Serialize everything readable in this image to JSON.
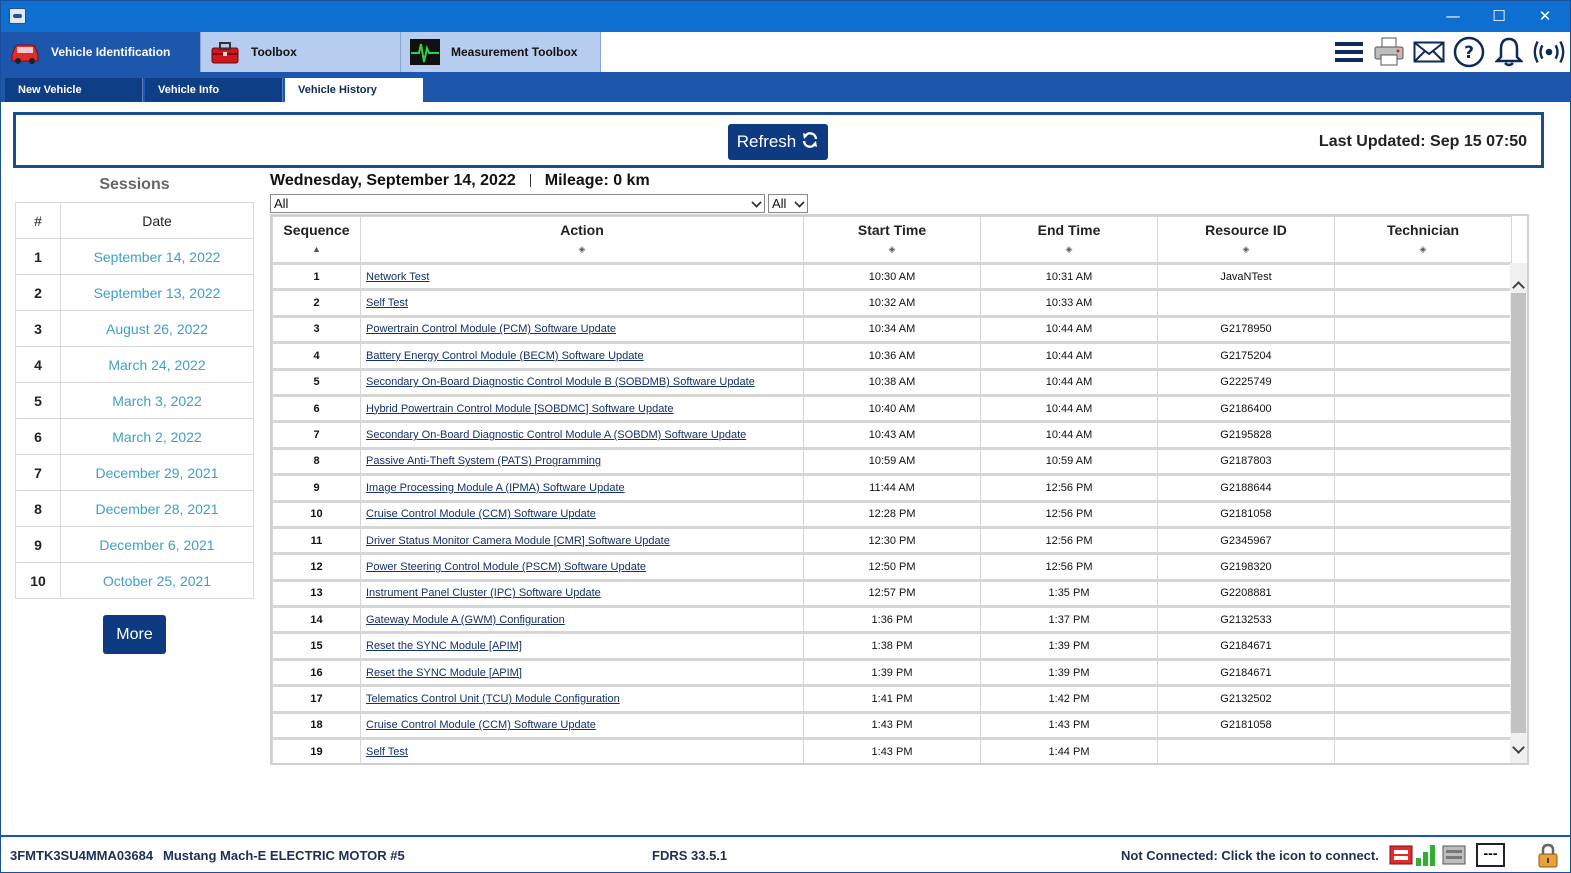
{
  "window": {
    "minimize_glyph": "—",
    "maximize_glyph": "☐",
    "close_glyph": "✕"
  },
  "main_tabs": [
    {
      "label": "Vehicle Identification",
      "icon": "car-icon"
    },
    {
      "label": "Toolbox",
      "icon": "toolbox-icon"
    },
    {
      "label": "Measurement Toolbox",
      "icon": "oscilloscope-icon"
    }
  ],
  "toolbar_icons": [
    "menu-icon",
    "printer-icon",
    "mail-icon",
    "help-icon",
    "bell-icon",
    "wireless-icon"
  ],
  "sub_tabs": [
    {
      "label": "New Vehicle"
    },
    {
      "label": "Vehicle Info"
    },
    {
      "label": "Vehicle History"
    }
  ],
  "refresh": {
    "label": "Refresh",
    "last_updated": "Last Updated: Sep 15 07:50"
  },
  "sessions": {
    "title": "Sessions",
    "col_num": "#",
    "col_date": "Date",
    "rows": [
      {
        "num": "1",
        "date": "September 14, 2022"
      },
      {
        "num": "2",
        "date": "September 13, 2022"
      },
      {
        "num": "3",
        "date": "August 26, 2022"
      },
      {
        "num": "4",
        "date": "March 24, 2022"
      },
      {
        "num": "5",
        "date": "March 3, 2022"
      },
      {
        "num": "6",
        "date": "March 2, 2022"
      },
      {
        "num": "7",
        "date": "December 29, 2021"
      },
      {
        "num": "8",
        "date": "December 28, 2021"
      },
      {
        "num": "9",
        "date": "December 6, 2021"
      },
      {
        "num": "10",
        "date": "October 25, 2021"
      }
    ],
    "more_label": "More"
  },
  "history": {
    "date": "Wednesday, September 14, 2022",
    "mileage": "Mileage: 0 km",
    "filter_action": "All",
    "filter_all": "All",
    "columns": [
      "Sequence",
      "Action",
      "Start Time",
      "End Time",
      "Resource ID",
      "Technician"
    ],
    "sort_asc_glyph": "▲",
    "sort_glyph": "◈",
    "rows": [
      {
        "seq": "1",
        "action": "Network Test",
        "start": "10:30 AM",
        "end": "10:31 AM",
        "resource": "JavaNTest",
        "tech": ""
      },
      {
        "seq": "2",
        "action": "Self Test",
        "start": "10:32 AM",
        "end": "10:33 AM",
        "resource": "",
        "tech": ""
      },
      {
        "seq": "3",
        "action": "Powertrain Control Module (PCM) Software Update",
        "start": "10:34 AM",
        "end": "10:44 AM",
        "resource": "G2178950",
        "tech": ""
      },
      {
        "seq": "4",
        "action": "Battery Energy Control Module (BECM) Software Update",
        "start": "10:36 AM",
        "end": "10:44 AM",
        "resource": "G2175204",
        "tech": ""
      },
      {
        "seq": "5",
        "action": "Secondary On-Board Diagnostic Control Module B (SOBDMB) Software Update",
        "start": "10:38 AM",
        "end": "10:44 AM",
        "resource": "G2225749",
        "tech": ""
      },
      {
        "seq": "6",
        "action": "Hybrid Powertrain Control Module [SOBDMC] Software Update",
        "start": "10:40 AM",
        "end": "10:44 AM",
        "resource": "G2186400",
        "tech": ""
      },
      {
        "seq": "7",
        "action": "Secondary On-Board Diagnostic Control Module A (SOBDM) Software Update",
        "start": "10:43 AM",
        "end": "10:44 AM",
        "resource": "G2195828",
        "tech": ""
      },
      {
        "seq": "8",
        "action": "Passive Anti-Theft System (PATS) Programming",
        "start": "10:59 AM",
        "end": "10:59 AM",
        "resource": "G2187803",
        "tech": ""
      },
      {
        "seq": "9",
        "action": "Image Processing Module A (IPMA) Software Update",
        "start": "11:44 AM",
        "end": "12:56 PM",
        "resource": "G2188644",
        "tech": ""
      },
      {
        "seq": "10",
        "action": "Cruise Control Module (CCM) Software Update",
        "start": "12:28 PM",
        "end": "12:56 PM",
        "resource": "G2181058",
        "tech": ""
      },
      {
        "seq": "11",
        "action": "Driver Status Monitor Camera Module [CMR] Software Update",
        "start": "12:30 PM",
        "end": "12:56 PM",
        "resource": "G2345967",
        "tech": ""
      },
      {
        "seq": "12",
        "action": "Power Steering Control Module (PSCM) Software Update",
        "start": "12:50 PM",
        "end": "12:56 PM",
        "resource": "G2198320",
        "tech": ""
      },
      {
        "seq": "13",
        "action": "Instrument Panel Cluster (IPC) Software Update",
        "start": "12:57 PM",
        "end": "1:35 PM",
        "resource": "G2208881",
        "tech": ""
      },
      {
        "seq": "14",
        "action": "Gateway Module A (GWM) Configuration",
        "start": "1:36 PM",
        "end": "1:37 PM",
        "resource": "G2132533",
        "tech": ""
      },
      {
        "seq": "15",
        "action": "Reset the SYNC Module [APIM]",
        "start": "1:38 PM",
        "end": "1:39 PM",
        "resource": "G2184671",
        "tech": ""
      },
      {
        "seq": "16",
        "action": "Reset the SYNC Module [APIM]",
        "start": "1:39 PM",
        "end": "1:39 PM",
        "resource": "G2184671",
        "tech": ""
      },
      {
        "seq": "17",
        "action": "Telematics Control Unit (TCU) Module Configuration",
        "start": "1:41 PM",
        "end": "1:42 PM",
        "resource": "G2132502",
        "tech": ""
      },
      {
        "seq": "18",
        "action": "Cruise Control Module (CCM) Software Update",
        "start": "1:43 PM",
        "end": "1:43 PM",
        "resource": "G2181058",
        "tech": ""
      },
      {
        "seq": "19",
        "action": "Self Test",
        "start": "1:43 PM",
        "end": "1:44 PM",
        "resource": "",
        "tech": ""
      }
    ]
  },
  "status": {
    "vin": "3FMTK3SU4MMA03684",
    "model": "Mustang Mach-E ELECTRIC MOTOR #5",
    "version": "FDRS 33.5.1",
    "connection": "Not Connected: Click the icon to connect.",
    "indicator": "---"
  },
  "colors": {
    "titlebar": "#0f6fd0",
    "brand_blue": "#1c56ad",
    "button_navy": "#0d3a80",
    "session_link": "#3ea0c8",
    "action_link": "#14316a"
  }
}
